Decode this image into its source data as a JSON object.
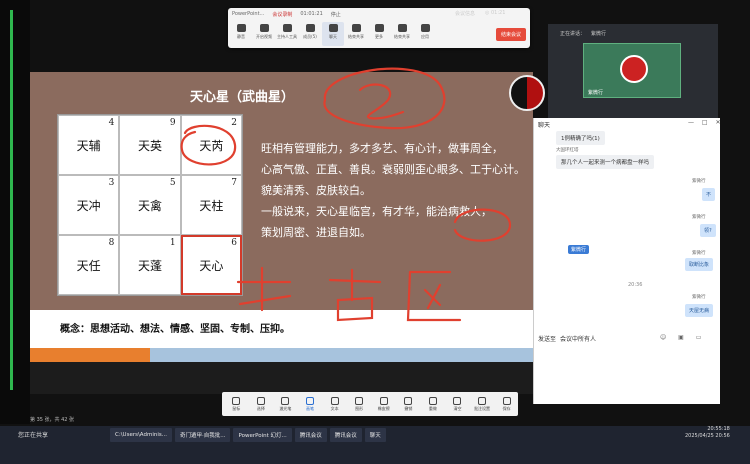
{
  "meeting_toolbar": {
    "tabs": [
      "PowerPoint...",
      "会议录制",
      "01:01:21",
      "停止"
    ],
    "buttons": [
      {
        "label": "静音",
        "icon": "mic-icon"
      },
      {
        "label": "开启视频",
        "icon": "camera-icon"
      },
      {
        "label": "主持人工具",
        "icon": "host-icon"
      },
      {
        "label": "成员(5)",
        "icon": "members-icon"
      },
      {
        "label": "聊天",
        "icon": "chat-icon"
      },
      {
        "label": "结束共享",
        "icon": "stop-share-icon"
      },
      {
        "label": "更多",
        "icon": "more-icon"
      },
      {
        "label": "结束共享",
        "icon": "share-icon"
      },
      {
        "label": "应用",
        "icon": "apps-icon"
      }
    ],
    "end_label": "结束会议"
  },
  "top_right": {
    "items": [
      "会议信息",
      "◎ 01:21"
    ]
  },
  "slide": {
    "title": "天心星（武曲星）",
    "grid": [
      {
        "name": "天辅",
        "num": "4"
      },
      {
        "name": "天英",
        "num": "9"
      },
      {
        "name": "天芮",
        "num": "2"
      },
      {
        "name": "天冲",
        "num": "3"
      },
      {
        "name": "天禽",
        "num": "5"
      },
      {
        "name": "天柱",
        "num": "7"
      },
      {
        "name": "天任",
        "num": "8"
      },
      {
        "name": "天蓬",
        "num": "1"
      },
      {
        "name": "天心",
        "num": "6"
      }
    ],
    "desc": [
      "旺相有管理能力，多才多艺、有心计，做事周全，",
      "心高气傲、正直、善良。衰弱则歪心眼多、工于心计。",
      "貌美清秀、皮肤较白。",
      "一般说来，天心星临宫，有才华，能治病救人，",
      "策划周密、进退自如。"
    ],
    "concept": "概念：思想活动、想法、情感、坚固、专制、压抑。"
  },
  "annotation_toolbar": {
    "items": [
      "鼠标",
      "选择",
      "激光笔",
      "画笔",
      "文本",
      "图形",
      "橡皮擦",
      "撤销",
      "重做",
      "清空",
      "批注设置",
      "保存"
    ],
    "active_index": 3
  },
  "video_panel": {
    "header": [
      "正在讲话：",
      "紫微行"
    ],
    "name": "紫微行"
  },
  "chat": {
    "title": "聊天",
    "messages": [
      {
        "side": "left",
        "sender": "",
        "text": "1例精确了吗(1)"
      },
      {
        "side": "left",
        "sender": "大国环红塔",
        "text": "那几个人一起来测一个病都盘一样吗"
      },
      {
        "side": "right",
        "sender": "紫微行",
        "text": "不"
      },
      {
        "side": "right",
        "sender": "紫微行",
        "text": "领?"
      },
      {
        "side": "right",
        "sender": "紫微行",
        "text": "取断比象"
      },
      {
        "side": "right",
        "sender": "紫微行",
        "text": "天屋无病"
      }
    ],
    "hp_tag": "紫微行",
    "time": "20:36",
    "send_to_label": "发送至",
    "send_to_value": "会议中所有人"
  },
  "taskbar": {
    "start_label": "您正在共享",
    "items": [
      "C:\\Users\\Adminis...",
      "奇门遁甲·自我批...",
      "PowerPoint 幻灯...",
      "腾讯会议",
      "腾讯会议",
      "聊天"
    ],
    "clock_time": "20:55:18",
    "clock_date": "2025/04/25 20:56"
  },
  "status_line": "第 35 张，共 42 张"
}
